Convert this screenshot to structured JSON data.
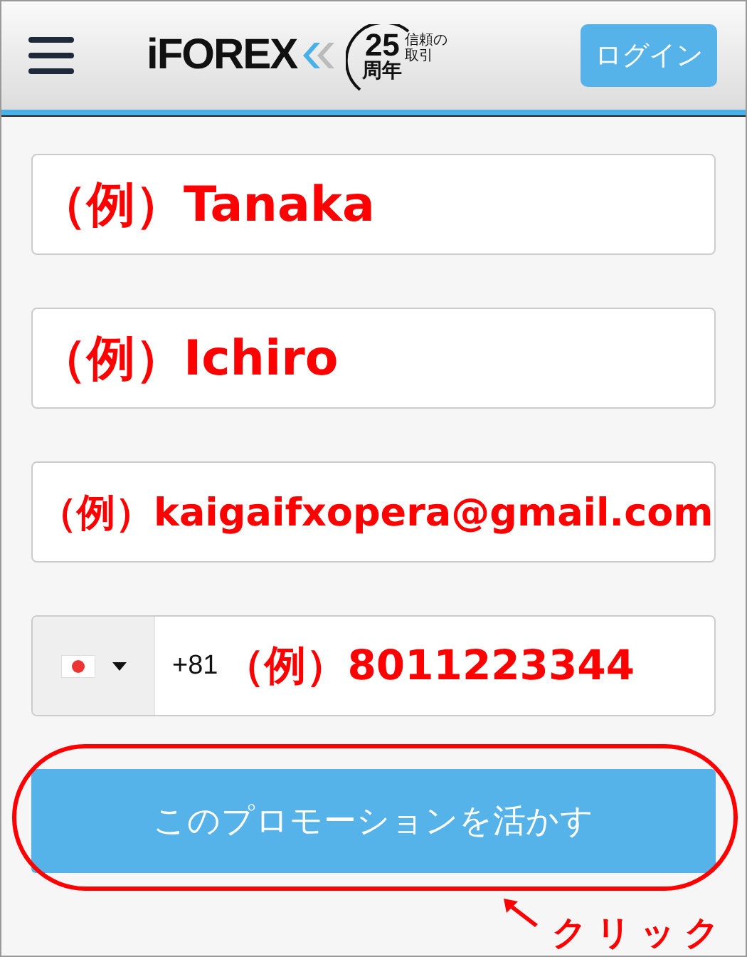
{
  "header": {
    "logo": {
      "brand": "iFOREX",
      "badge_number": "25",
      "badge_unit": "周年",
      "badge_caption_1": "信頼の",
      "badge_caption_2": "取引"
    },
    "login_button": "ログイン"
  },
  "fields": [
    {
      "kind": "text",
      "value": "（例）Tanaka"
    },
    {
      "kind": "text",
      "value": "（例）Ichiro"
    },
    {
      "kind": "text",
      "value": "（例）kaigaifxopera@gmail.com"
    },
    {
      "kind": "phone",
      "dial_code": "+81",
      "value": "（例）8011223344"
    }
  ],
  "submit_button": "このプロモーションを活かす",
  "annotation": {
    "label": "クリック"
  }
}
